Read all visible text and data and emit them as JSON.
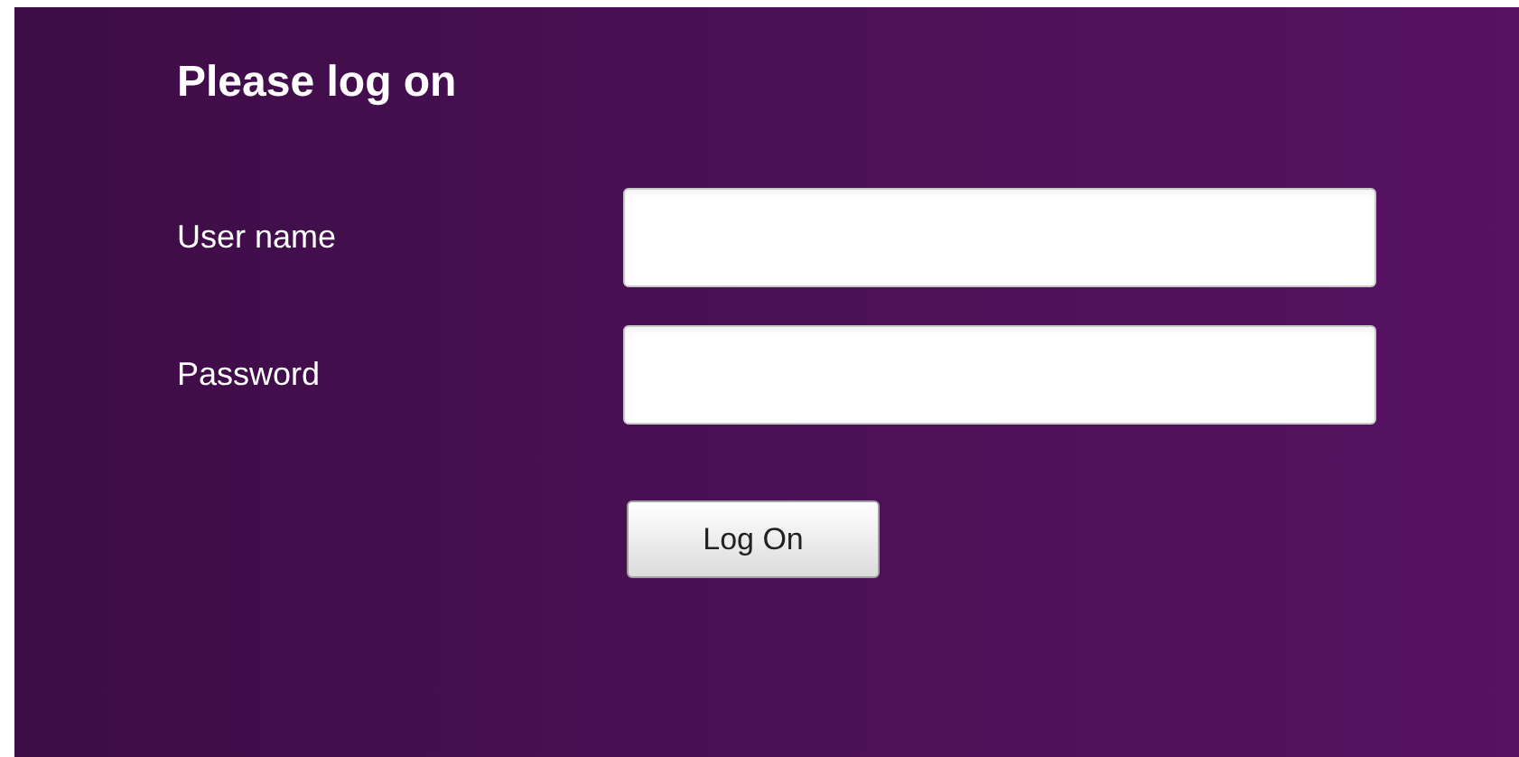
{
  "title": "Please log on",
  "fields": [
    {
      "label": "User name"
    },
    {
      "label": "Password"
    }
  ],
  "button": "Log On"
}
